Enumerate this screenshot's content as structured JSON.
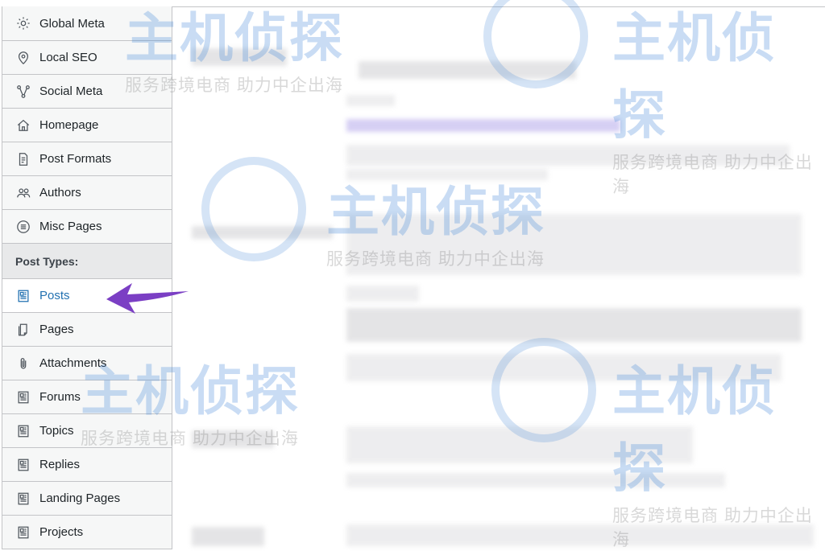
{
  "sidebar": {
    "items": [
      {
        "id": "global-meta",
        "label": "Global Meta",
        "icon": "gear-icon"
      },
      {
        "id": "local-seo",
        "label": "Local SEO",
        "icon": "map-pin-icon"
      },
      {
        "id": "social-meta",
        "label": "Social Meta",
        "icon": "share-icon"
      },
      {
        "id": "homepage",
        "label": "Homepage",
        "icon": "home-icon"
      },
      {
        "id": "post-formats",
        "label": "Post Formats",
        "icon": "document-icon"
      },
      {
        "id": "authors",
        "label": "Authors",
        "icon": "users-icon"
      },
      {
        "id": "misc-pages",
        "label": "Misc Pages",
        "icon": "list-circle-icon"
      }
    ],
    "post_types_heading": "Post Types:",
    "post_types": [
      {
        "id": "posts",
        "label": "Posts",
        "icon": "post-icon",
        "active": true
      },
      {
        "id": "pages",
        "label": "Pages",
        "icon": "page-icon"
      },
      {
        "id": "attachments",
        "label": "Attachments",
        "icon": "paperclip-icon"
      },
      {
        "id": "forums",
        "label": "Forums",
        "icon": "post-icon"
      },
      {
        "id": "topics",
        "label": "Topics",
        "icon": "post-icon"
      },
      {
        "id": "replies",
        "label": "Replies",
        "icon": "post-icon"
      },
      {
        "id": "landing-pages",
        "label": "Landing Pages",
        "icon": "post-icon"
      },
      {
        "id": "projects",
        "label": "Projects",
        "icon": "post-icon"
      }
    ]
  },
  "watermark": {
    "title": "主机侦探",
    "subtitle": "服务跨境电商 助力中企出海"
  },
  "colors": {
    "active_text": "#2271b1",
    "arrow": "#7b3fc4",
    "border": "#c3c4c7"
  }
}
